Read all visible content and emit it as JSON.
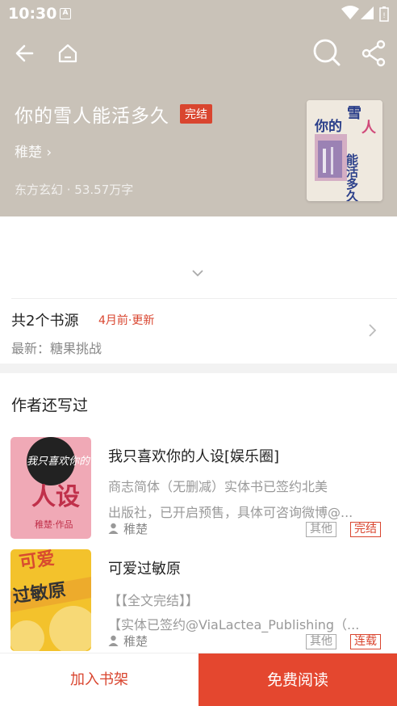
{
  "status_bar": {
    "time": "10:30",
    "notification_icon": "A"
  },
  "book": {
    "title": "你的雪人能活多久",
    "status_tag": "完结",
    "author": "稚楚 ›",
    "meta": "东方玄幻 · 53.57万字",
    "cover_text_top": "你的雪人",
    "cover_text_side": "能活多久"
  },
  "sources": {
    "count_text": "共2个书源",
    "update_text": "4月前·更新",
    "latest_text": "最新：糖果挑战"
  },
  "other_works": {
    "section_title": "作者还写过",
    "items": [
      {
        "title": "我只喜欢你的人设[娱乐圈]",
        "desc_line1": "商志简体（无删减）实体书已签约北美",
        "desc_line2": "出版社，已开启预售，具体可咨询微博@...",
        "author": "稚楚",
        "tag1": "其他",
        "tag2": "完结",
        "cover_text": "人设"
      },
      {
        "title": "可爱过敏原",
        "desc_line1": "【【全文完结】】",
        "desc_line2": "【实体已签约@ViaLactea_Publishing（...",
        "author": "稚楚",
        "tag1": "其他",
        "tag2": "连载",
        "cover_text": "可爱过敏原"
      }
    ]
  },
  "bottom_bar": {
    "add_shelf": "加入书架",
    "read_free": "免费阅读"
  },
  "icons": {
    "back": "back-arrow-icon",
    "home": "home-icon",
    "search": "search-icon",
    "share": "share-icon",
    "expand": "chevron-down-icon",
    "source_arrow": "chevron-right-icon",
    "author": "person-icon"
  },
  "colors": {
    "header_bg": "#c9c2b8",
    "accent": "#e4472f"
  }
}
